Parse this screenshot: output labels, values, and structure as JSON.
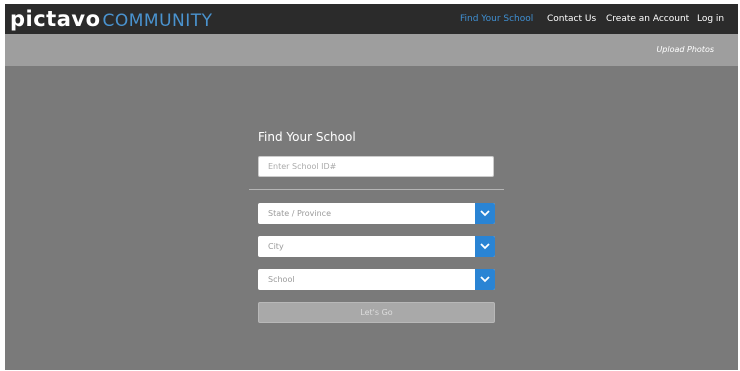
{
  "brand": {
    "logo": "pictavo",
    "tagline": "COMMUNITY",
    "accent": "#4a93cf"
  },
  "nav": {
    "items": [
      {
        "label": "Find Your School",
        "active": true
      },
      {
        "label": "Contact Us",
        "active": false
      },
      {
        "label": "Create an Account",
        "active": false
      },
      {
        "label": "Log in",
        "active": false
      }
    ]
  },
  "subnav": {
    "upload_label": "Upload Photos"
  },
  "form": {
    "title": "Find Your School",
    "school_id": {
      "placeholder": "Enter School ID#",
      "value": ""
    },
    "selects": [
      {
        "label": "State / Province",
        "icon": "chevron-down-icon"
      },
      {
        "label": "City",
        "icon": "chevron-down-icon"
      },
      {
        "label": "School",
        "icon": "chevron-down-icon"
      }
    ],
    "submit_label": "Let's Go"
  },
  "colors": {
    "topbar": "#2b2b2b",
    "subbar": "#9e9e9e",
    "background": "#7a7a7a",
    "select_arrow": "#2a84d4",
    "nav_active": "#3f8fd2"
  }
}
